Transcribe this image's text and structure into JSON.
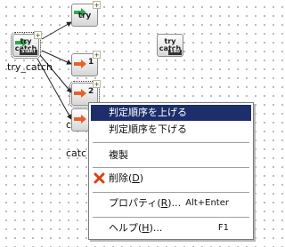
{
  "colors": {
    "menu_highlight": "#1d2e6b",
    "node_arrow": "#2fa84f",
    "delete_icon": "#e04010"
  },
  "nodes": {
    "try": {
      "text": "try",
      "badge": "+"
    },
    "try_catch_start": {
      "text": "try\ncatch",
      "foot": "START",
      "badge": "+",
      "label": "try_catch"
    },
    "try_catch_end": {
      "text": "try\ncatch",
      "foot": "END"
    },
    "catch1": {
      "number": "1",
      "badge": "+"
    },
    "catch2": {
      "number": "2",
      "badge": "+"
    },
    "catch3_label": "c",
    "catch_label": "catc"
  },
  "context_menu": {
    "items": [
      {
        "label": "判定順序を上げる",
        "shortcut": ""
      },
      {
        "label": "判定順序を下げる",
        "shortcut": ""
      },
      {
        "label": "複製",
        "shortcut": ""
      },
      {
        "label": "削除(",
        "mnemonic": "D",
        "suffix": ")",
        "shortcut": "",
        "icon": "delete-x-icon"
      },
      {
        "label": "プロパティ(",
        "mnemonic": "R",
        "suffix": ")...",
        "shortcut": "Alt+Enter"
      },
      {
        "label": "ヘルプ(",
        "mnemonic": "H",
        "suffix": ")...",
        "shortcut": "F1"
      }
    ]
  }
}
